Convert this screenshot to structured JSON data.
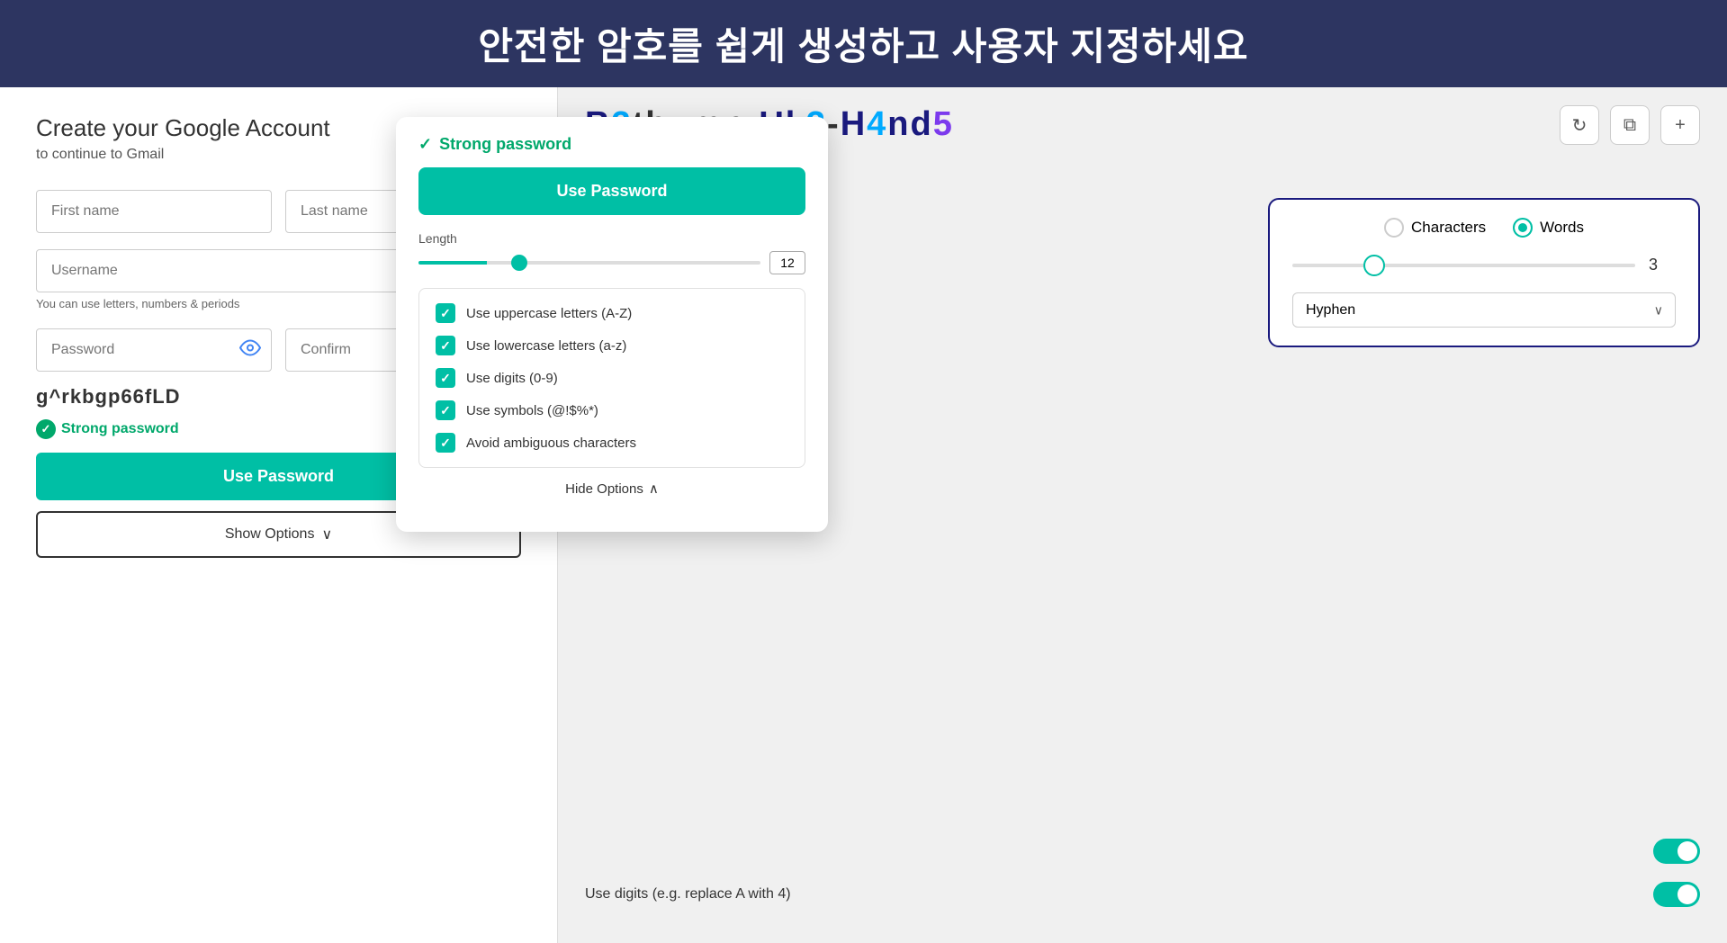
{
  "header": {
    "text": "안전한 암호를 쉽게 생성하고 사용자 지정하세요"
  },
  "left_panel": {
    "title": "Create your Google Account",
    "subtitle": "to continue to Gmail",
    "first_name_placeholder": "First name",
    "last_name_placeholder": "Last name",
    "username_placeholder": "Username",
    "username_helper": "You can use letters, numbers & periods",
    "password_placeholder": "Password",
    "confirm_placeholder": "Confirm",
    "generated_password": "g^rkbgp66fLD",
    "strong_label": "Strong password",
    "use_password_btn": "Use Password",
    "show_options_btn": "Show Options"
  },
  "popup": {
    "strong_label": "Strong password",
    "use_password_btn": "Use Password",
    "length_label": "Length",
    "length_value": "12",
    "options": [
      {
        "label": "Use uppercase letters (A-Z)",
        "checked": true
      },
      {
        "label": "Use lowercase letters (a-z)",
        "checked": true
      },
      {
        "label": "Use digits (0-9)",
        "checked": true
      },
      {
        "label": "Use symbols (@!$%*)",
        "checked": true
      },
      {
        "label": "Avoid ambiguous characters",
        "checked": true
      }
    ],
    "hide_options_btn": "Hide Options"
  },
  "right_panel": {
    "password_display": "B3thump-Uk3-H4nd5",
    "characters_label": "Characters",
    "words_label": "Words",
    "word_count": "3",
    "separator_label": "Hyphen",
    "use_digits_label": "Use digits (e.g. replace A with 4)",
    "icons": {
      "refresh": "↻",
      "copy": "⧉",
      "add": "+"
    }
  }
}
